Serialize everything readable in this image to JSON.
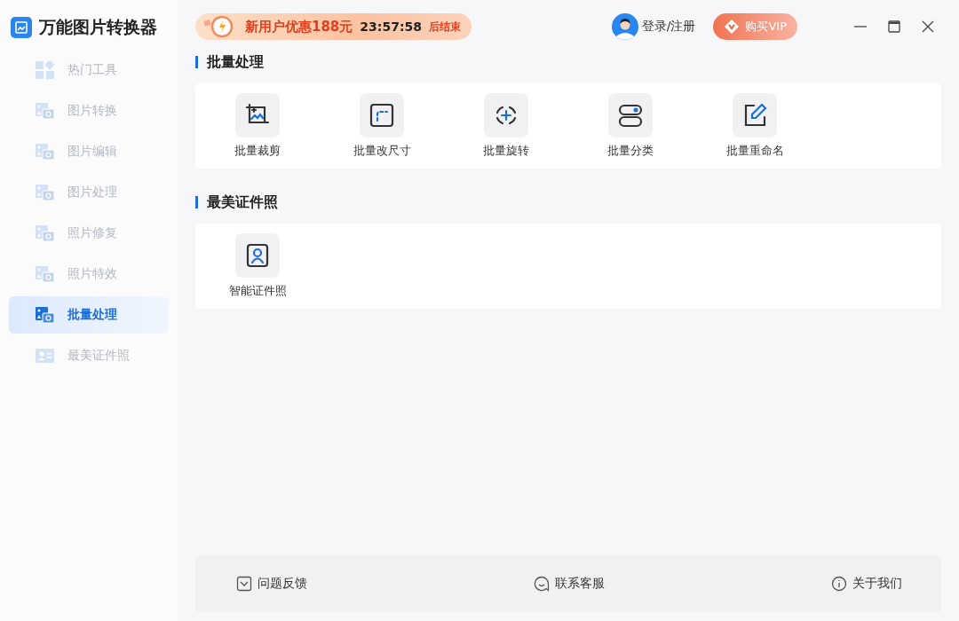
{
  "app": {
    "title": "万能图片转换器"
  },
  "promo": {
    "text": "新用户优惠188元",
    "countdown": "23:57:58",
    "suffix": "后结束"
  },
  "account": {
    "login": "登录/注册",
    "vip": "购买VIP"
  },
  "sidebar": {
    "items": [
      {
        "label": "热门工具",
        "kind": "grid",
        "selected": false
      },
      {
        "label": "图片转换",
        "kind": "image",
        "selected": false
      },
      {
        "label": "图片编辑",
        "kind": "image",
        "selected": false
      },
      {
        "label": "图片处理",
        "kind": "image",
        "selected": false
      },
      {
        "label": "照片修复",
        "kind": "image",
        "selected": false
      },
      {
        "label": "照片特效",
        "kind": "image",
        "selected": false
      },
      {
        "label": "批量处理",
        "kind": "image",
        "selected": true
      },
      {
        "label": "最美证件照",
        "kind": "person",
        "selected": false
      }
    ]
  },
  "sections": [
    {
      "title": "批量处理",
      "tools": [
        {
          "label": "批量裁剪",
          "kind": "crop"
        },
        {
          "label": "批量改尺寸",
          "kind": "resize"
        },
        {
          "label": "批量旋转",
          "kind": "rotate"
        },
        {
          "label": "批量分类",
          "kind": "classify"
        },
        {
          "label": "批量重命名",
          "kind": "rename"
        }
      ]
    },
    {
      "title": "最美证件照",
      "tools": [
        {
          "label": "智能证件照",
          "kind": "idphoto"
        }
      ]
    }
  ],
  "footer": [
    {
      "label": "问题反馈",
      "kind": "feedback"
    },
    {
      "label": "联系客服",
      "kind": "chat"
    },
    {
      "label": "关于我们",
      "kind": "info"
    }
  ]
}
